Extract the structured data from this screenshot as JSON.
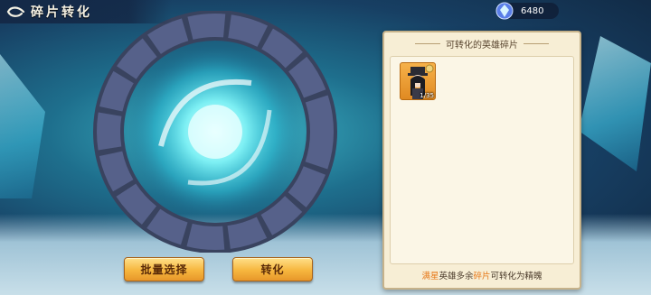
{
  "header": {
    "title": "碎片转化"
  },
  "currency": {
    "amount": "6480",
    "icon": "crystal-gem-icon"
  },
  "panel": {
    "title": "可转化的英雄碎片",
    "hero_items": [
      {
        "count": "1/35"
      }
    ],
    "footer": {
      "part1": "满星",
      "part2": "英雄多余",
      "part3": "碎片",
      "part4": "可转化为精魄"
    }
  },
  "buttons": {
    "batch_select": "批量选择",
    "convert": "转化"
  },
  "colors": {
    "button_gold": "#f6b63e",
    "panel_bg": "#f7eed5",
    "highlight": "#e77a1b"
  }
}
